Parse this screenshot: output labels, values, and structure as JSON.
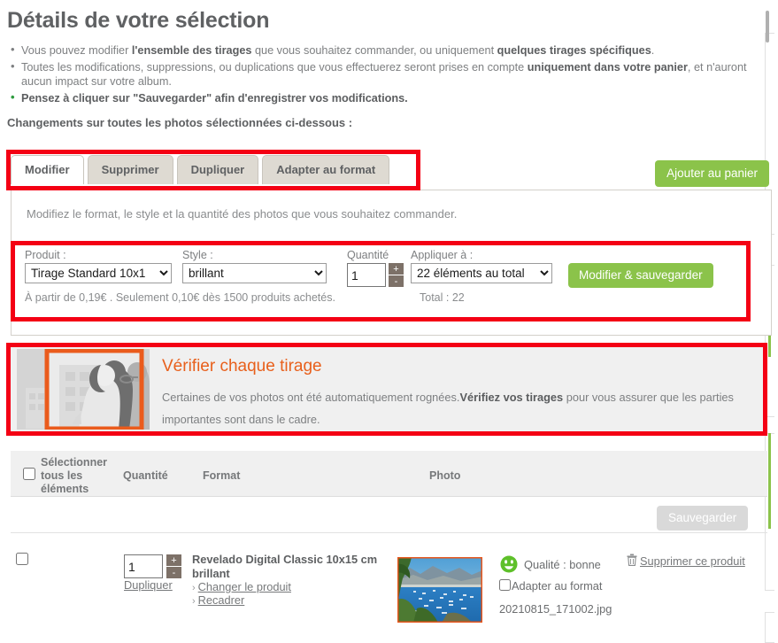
{
  "page": {
    "title": "Détails de votre sélection",
    "changes_label": "Changements sur toutes les photos sélectionnées ci-dessous :"
  },
  "intro_bullets": [
    {
      "parts": [
        {
          "text": "Vous pouvez modifier ",
          "bold": false
        },
        {
          "text": "l'ensemble des tirages",
          "bold": true
        },
        {
          "text": " que vous souhaitez commander, ou uniquement ",
          "bold": false
        },
        {
          "text": "quelques tirages spécifiques",
          "bold": true
        },
        {
          "text": ".",
          "bold": false
        }
      ],
      "green": false
    },
    {
      "parts": [
        {
          "text": "Toutes les modifications, suppressions, ou duplications que vous effectuerez seront prises en compte ",
          "bold": false
        },
        {
          "text": "uniquement dans votre panier",
          "bold": true
        },
        {
          "text": ", et n'auront aucun impact sur votre album.",
          "bold": false
        }
      ],
      "green": false
    },
    {
      "parts": [
        {
          "text": "Pensez à cliquer sur \"Sauvegarder\" afin d'enregistrer vos modifications.",
          "bold": true
        }
      ],
      "green": true
    }
  ],
  "tabs": [
    {
      "label": "Modifier",
      "active": true
    },
    {
      "label": "Supprimer",
      "active": false
    },
    {
      "label": "Dupliquer",
      "active": false
    },
    {
      "label": "Adapter au format",
      "active": false
    }
  ],
  "buttons": {
    "add_to_cart": "Ajouter au panier",
    "modify_and_save": "Modifier & sauvegarder",
    "save": "Sauvegarder",
    "save_disabled": true
  },
  "panel": {
    "description": "Modifiez le format, le style et la quantité des photos que vous souhaitez commander."
  },
  "form": {
    "product_label": "Produit :",
    "product_value": "Tirage Standard 10x1",
    "product_options": [
      "Tirage Standard 10x1"
    ],
    "style_label": "Style :",
    "style_value": "brillant",
    "style_options": [
      "brillant"
    ],
    "quantity_label": "Quantité",
    "quantity_value": "1",
    "stepper_plus": "+",
    "stepper_minus": "-",
    "apply_label": "Appliquer à :",
    "apply_value": "22 éléments au total",
    "apply_options": [
      "22 éléments au total"
    ],
    "price_note": "À partir de 0,19€ . Seulement 0,10€ dès 1500 produits achetés.",
    "total_note": "Total : 22"
  },
  "verify": {
    "title": "Vérifier chaque tirage",
    "text_parts": [
      {
        "text": "Certaines de vos photos ont été automatiquement rognées.",
        "bold": false
      },
      {
        "text": "Vérifiez vos tirages",
        "bold": true
      },
      {
        "text": " pour vous assurer que les parties importantes sont dans le cadre.",
        "bold": false
      }
    ],
    "thumb_icon": "crop-preview-illustration"
  },
  "table": {
    "headers": {
      "select_all": "Sélectionner tous les éléments",
      "quantity": "Quantité",
      "format": "Format",
      "photo": "Photo"
    },
    "select_all_checked": false
  },
  "row": {
    "checked": false,
    "quantity": "1",
    "stepper_plus": "+",
    "stepper_minus": "-",
    "duplicate_label": "Dupliquer",
    "product_title": "Revelado Digital Classic 10x15 cm brillant",
    "change_product_label": "Changer le produit",
    "crop_label": "Recadrer",
    "chevron": "›",
    "quality_text": "Qualité : bonne",
    "quality_icon": "smiley-green-icon",
    "fit_to_format_label": "Adapter au format",
    "fit_to_format_checked": false,
    "file_name": "20210815_171002.jpg",
    "delete_label": "Supprimer ce produit",
    "delete_icon": "trash-icon",
    "photo_icon": "harbor-photo-thumbnail"
  },
  "colors": {
    "highlight_red": "#f40014",
    "accent_green": "#8bc34a",
    "orange": "#e8601c",
    "text_grey": "#7d7f81"
  }
}
